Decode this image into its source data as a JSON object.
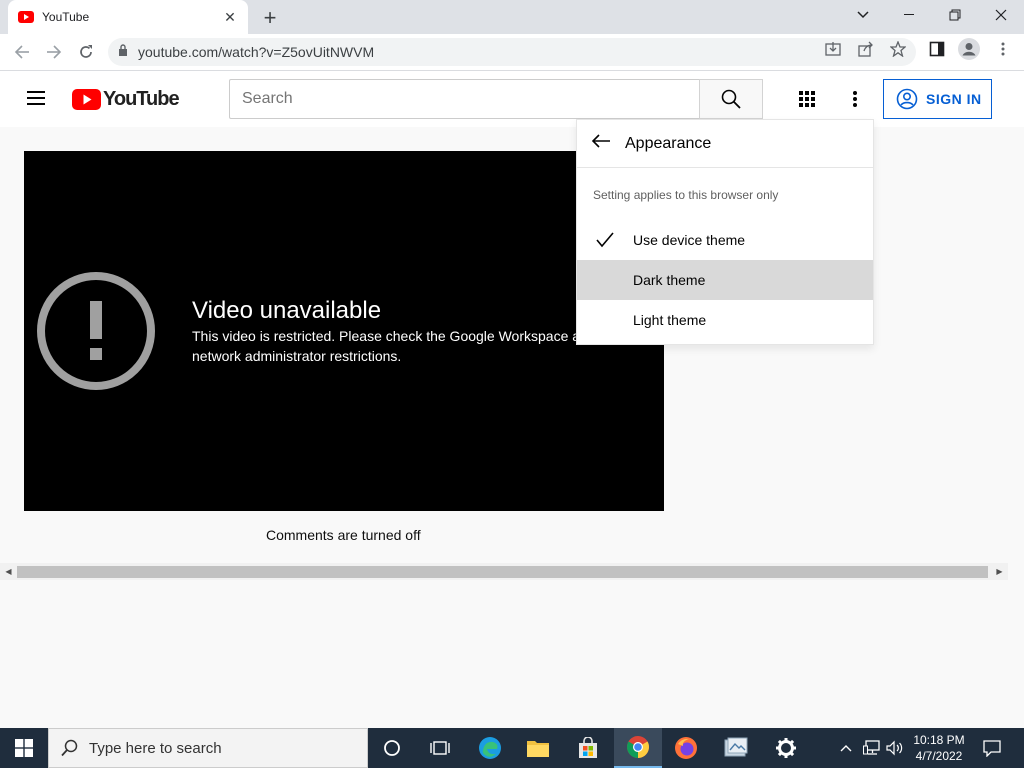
{
  "browser": {
    "tab_title": "YouTube",
    "url": "youtube.com/watch?v=Z5ovUitNWVM"
  },
  "youtube": {
    "logo_text": "YouTube",
    "search_placeholder": "Search",
    "sign_in_label": "SIGN IN",
    "video_error_title": "Video unavailable",
    "video_error_message": "This video is restricted. Please check the Google Workspace administrator and/or the network administrator restrictions.",
    "comments_status": "Comments are turned off"
  },
  "appearance_menu": {
    "title": "Appearance",
    "note": "Setting applies to this browser only",
    "options": [
      {
        "label": "Use device theme",
        "selected": true
      },
      {
        "label": "Dark theme",
        "selected": false,
        "hovered": true
      },
      {
        "label": "Light theme",
        "selected": false
      }
    ]
  },
  "taskbar": {
    "search_placeholder": "Type here to search",
    "time": "10:18 PM",
    "date": "4/7/2022"
  },
  "colors": {
    "youtube_red": "#ff0000",
    "link_blue": "#065fd4",
    "taskbar": "#1f2d3d"
  }
}
